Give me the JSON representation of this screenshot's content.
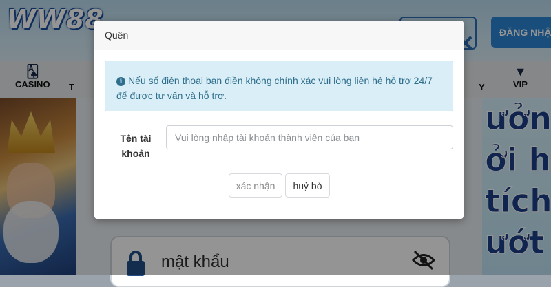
{
  "site": {
    "logo": "WW88",
    "register_label": "ĐĂNG NHẬP",
    "nav": {
      "casino": "CASINO",
      "t": "T",
      "y": "Y",
      "vip": "VIP"
    },
    "banner_right_lines": [
      "ưởng",
      "ởi hạ",
      "tích l",
      "ướt"
    ],
    "password_placeholder": "mật khẩu"
  },
  "modal": {
    "title": "Quên",
    "alert_text": "Nếu số điện thoại bạn điền không chính xác vui lòng liên hệ hỗ trợ 24/7 để được tư vấn và hỗ trợ.",
    "username_label": "Tên tài khoản",
    "username_placeholder": "Vui lòng nhập tài khoản thành viên của bạn",
    "confirm_label": "xác nhận",
    "cancel_label": "huỷ bỏ"
  },
  "colors": {
    "alert_bg": "#d9eef6",
    "alert_text": "#2f6f8d",
    "overlay": "rgba(0,0,0,0.42)",
    "brand_blue": "#2a86d6"
  }
}
